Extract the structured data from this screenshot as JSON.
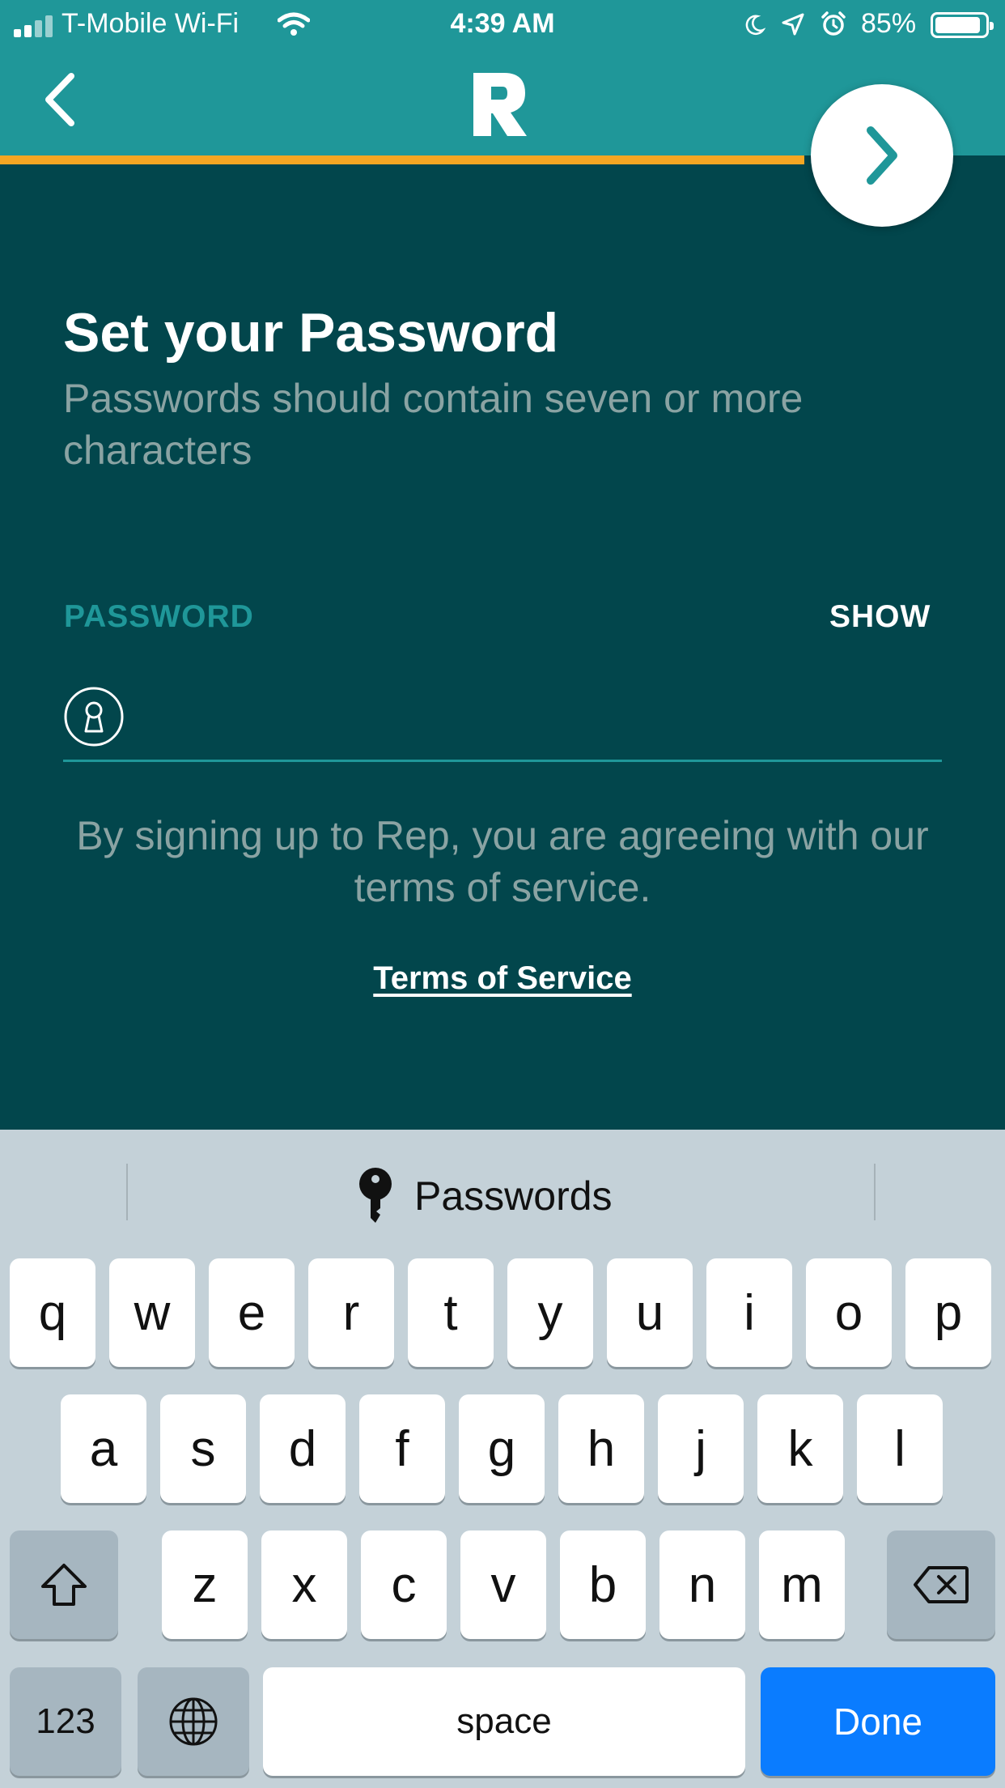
{
  "status_bar": {
    "carrier": "T-Mobile Wi-Fi",
    "time": "4:39 AM",
    "battery": "85%"
  },
  "onboarding": {
    "progress": 0.8
  },
  "content": {
    "title": "Set your Password",
    "subtitle": "Passwords should contain seven or more characters",
    "password_label": "PASSWORD",
    "show_label": "SHOW",
    "password_value": "",
    "terms_text": "By signing up to Rep, you are agreeing with our terms of service.",
    "terms_link": "Terms of Service"
  },
  "keyboard": {
    "suggestion": "Passwords",
    "row1": [
      "q",
      "w",
      "e",
      "r",
      "t",
      "y",
      "u",
      "i",
      "o",
      "p"
    ],
    "row2": [
      "a",
      "s",
      "d",
      "f",
      "g",
      "h",
      "j",
      "k",
      "l"
    ],
    "row3": [
      "z",
      "x",
      "c",
      "v",
      "b",
      "n",
      "m"
    ],
    "numbers_label": "123",
    "space_label": "space",
    "done_label": "Done"
  },
  "colors": {
    "header": "#1f9799",
    "background": "#02464c",
    "accent": "#f5a623",
    "done_key": "#0a7cff"
  },
  "icons": [
    "back-chevron-icon",
    "rep-logo",
    "next-chevron-icon",
    "lock-keyhole-icon",
    "key-icon",
    "shift-icon",
    "backspace-icon",
    "globe-icon"
  ]
}
